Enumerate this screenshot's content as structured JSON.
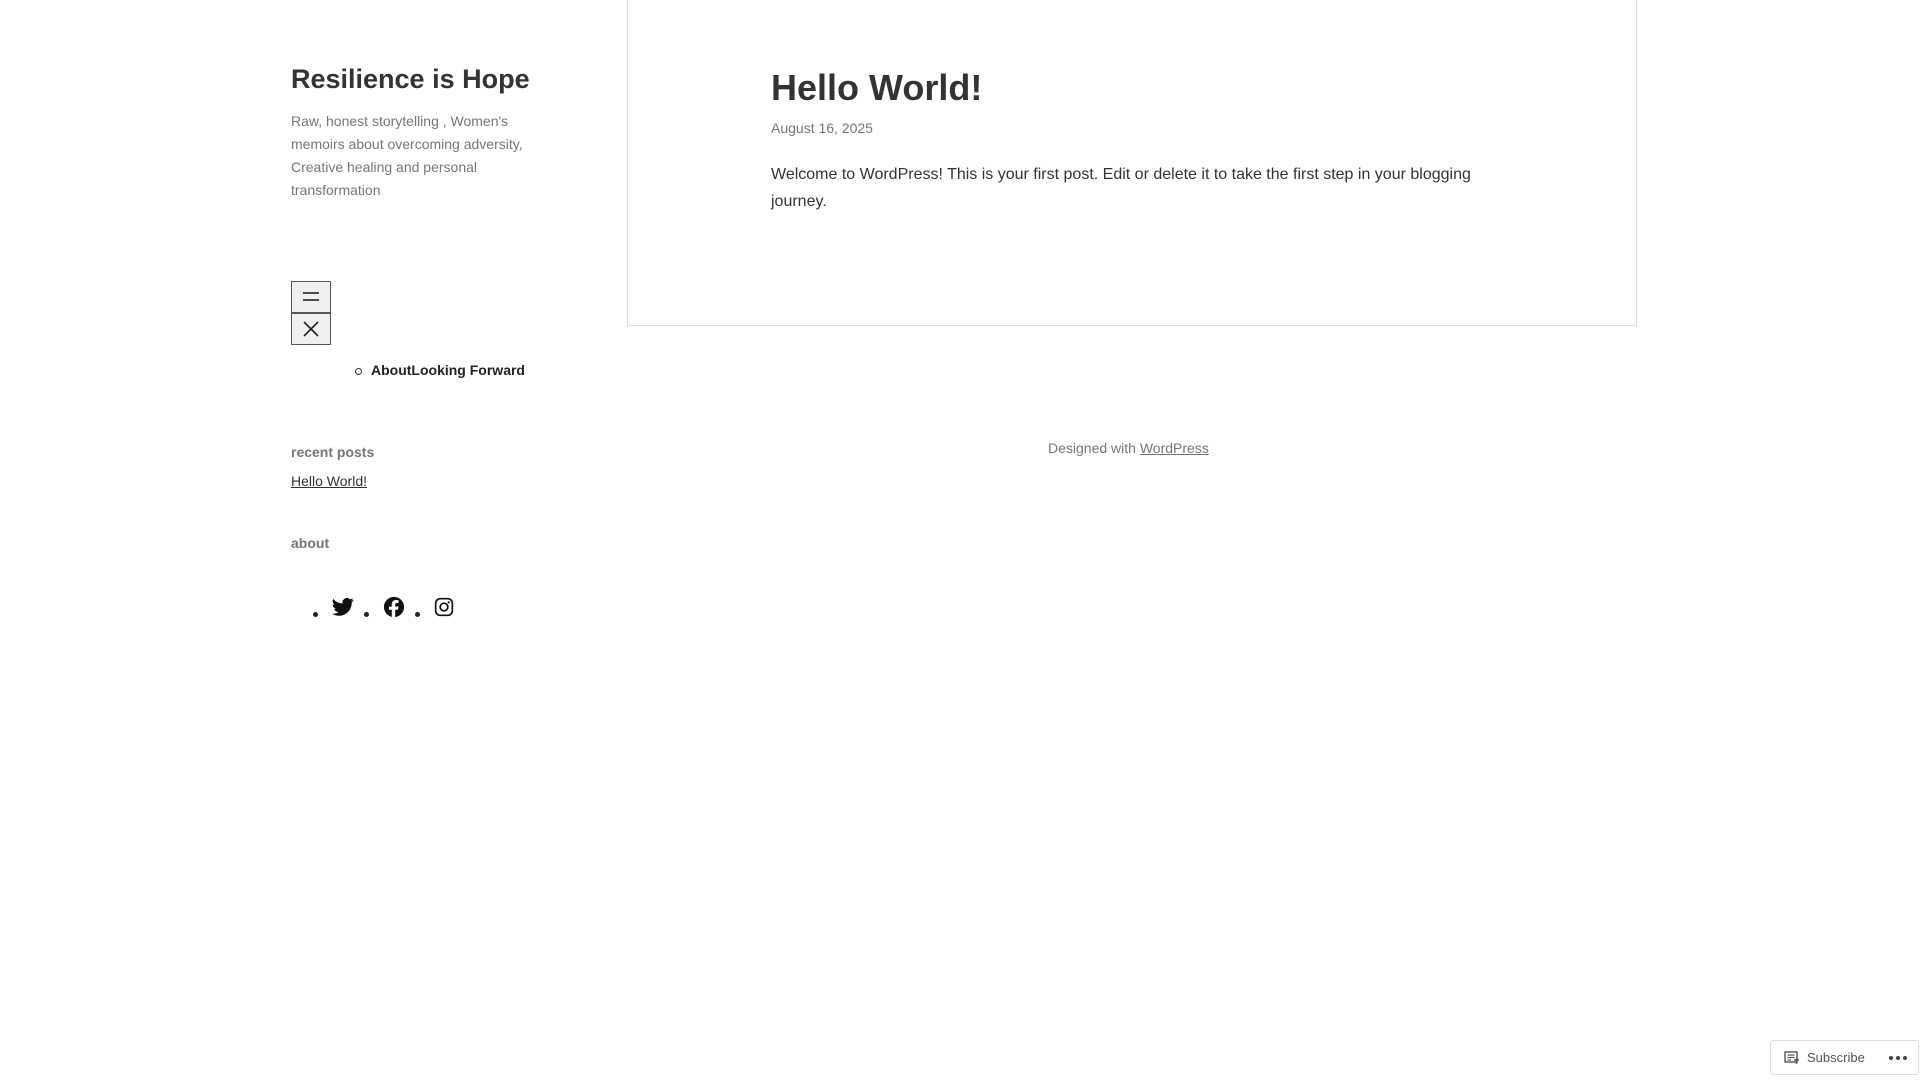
{
  "site": {
    "title": "Resilience is Hope",
    "description": "Raw, honest storytelling , Women's memoirs about overcoming adversity, Creative healing and personal transformation"
  },
  "nav": {
    "open_icon": "hamburger-menu-icon",
    "close_icon": "close-icon",
    "items": [
      {
        "label": "AboutLooking Forward"
      }
    ]
  },
  "widgets": {
    "recent_posts_title": "recent posts",
    "recent_posts": [
      {
        "label": "Hello World!"
      }
    ],
    "about_title": "about",
    "social": [
      {
        "icon": "twitter-icon"
      },
      {
        "icon": "facebook-icon"
      },
      {
        "icon": "instagram-icon"
      }
    ]
  },
  "post": {
    "title": "Hello World!",
    "date": "August 16, 2025",
    "body": "Welcome to WordPress! This is your first post. Edit or delete it to take the first step in your blogging journey."
  },
  "footer": {
    "prefix": "Designed with ",
    "link": "WordPress"
  },
  "subscribe": {
    "label": "Subscribe",
    "icon": "reader-icon",
    "more_icon": "ellipsis-icon"
  }
}
